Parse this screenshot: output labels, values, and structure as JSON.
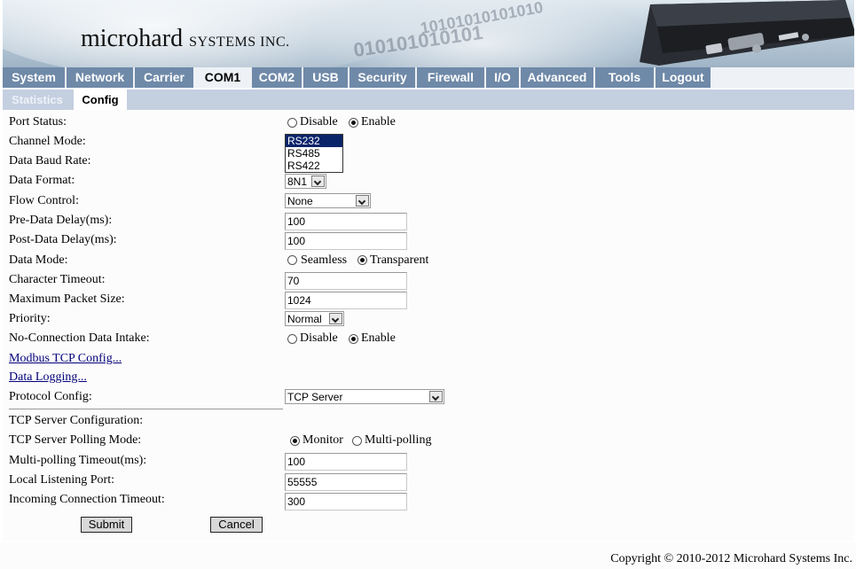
{
  "header": {
    "logo_main": "microhard",
    "logo_sub": "SYSTEMS INC.",
    "binary_1": "010101010101",
    "binary_2": "10101010101010"
  },
  "nav": {
    "tabs": [
      {
        "label": "System"
      },
      {
        "label": "Network"
      },
      {
        "label": "Carrier"
      },
      {
        "label": "COM1",
        "active": true
      },
      {
        "label": "COM2"
      },
      {
        "label": "USB"
      },
      {
        "label": "Security"
      },
      {
        "label": "Firewall"
      },
      {
        "label": "I/O"
      },
      {
        "label": "Advanced"
      },
      {
        "label": "Tools"
      },
      {
        "label": "Logout"
      }
    ]
  },
  "subnav": {
    "tabs": [
      {
        "label": "Statistics",
        "active": false
      },
      {
        "label": "Config",
        "active": true
      }
    ]
  },
  "form": {
    "port_status": {
      "label": "Port Status:",
      "opt1": "Disable",
      "opt2": "Enable",
      "selected": "Enable"
    },
    "channel_mode": {
      "label": "Channel Mode:",
      "options": [
        "RS232",
        "RS485",
        "RS422"
      ],
      "highlighted": "RS232"
    },
    "baud_rate": {
      "label": "Data Baud Rate:"
    },
    "data_format": {
      "label": "Data Format:",
      "value": "8N1"
    },
    "flow_control": {
      "label": "Flow Control:",
      "value": "None"
    },
    "pre_delay": {
      "label": "Pre-Data Delay(ms):",
      "value": "100"
    },
    "post_delay": {
      "label": "Post-Data Delay(ms):",
      "value": "100"
    },
    "data_mode": {
      "label": "Data Mode:",
      "opt1": "Seamless",
      "opt2": "Transparent",
      "selected": "Transparent"
    },
    "char_timeout": {
      "label": "Character Timeout:",
      "value": "70"
    },
    "max_packet": {
      "label": "Maximum Packet Size:",
      "value": "1024"
    },
    "priority": {
      "label": "Priority:",
      "value": "Normal"
    },
    "no_conn": {
      "label": "No-Connection Data Intake:",
      "opt1": "Disable",
      "opt2": "Enable",
      "selected": "Enable"
    },
    "modbus_link": "Modbus TCP Config...",
    "logging_link": "Data Logging...",
    "protocol": {
      "label": "Protocol Config:",
      "value": "TCP Server"
    },
    "tcp_server_cfg": "TCP Server Configuration:",
    "polling_mode": {
      "label": "TCP Server Polling Mode:",
      "opt1": "Monitor",
      "opt2": "Multi-polling",
      "selected": "Monitor"
    },
    "multipoll_timeout": {
      "label": "Multi-polling Timeout(ms):",
      "value": "100"
    },
    "listen_port": {
      "label": "Local Listening Port:",
      "value": "55555"
    },
    "incoming_timeout": {
      "label": "Incoming Connection Timeout:",
      "value": "300"
    },
    "submit_label": "Submit",
    "cancel_label": "Cancel"
  },
  "footer": {
    "copyright": "Copyright © 2010-2012 Microhard Systems Inc."
  },
  "colors": {
    "nav_bg": "#6f89a8",
    "subnav_bg": "#c4cfe0",
    "link": "#00007a"
  }
}
